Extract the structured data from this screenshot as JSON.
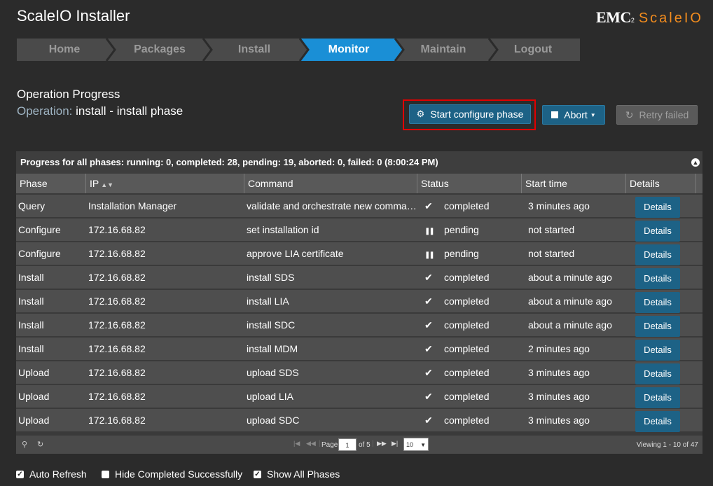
{
  "app": {
    "title": "ScaleIO Installer",
    "logo_brand": "EMC",
    "logo_sup": "2",
    "logo_product": "ScaleIO"
  },
  "wizard": {
    "steps": [
      "Home",
      "Packages",
      "Install",
      "Monitor",
      "Maintain",
      "Logout"
    ],
    "active_index": 3
  },
  "operation": {
    "heading": "Operation Progress",
    "label": "Operation:",
    "value": "install - install phase"
  },
  "actions": {
    "start_configure": "Start configure phase",
    "abort": "Abort",
    "retry_failed": "Retry failed"
  },
  "grid": {
    "caption": "Progress for all phases: running: 0, completed: 28, pending: 19, aborted: 0, failed: 0 (8:00:24 PM)",
    "columns": [
      "Phase",
      "IP",
      "Command",
      "Status",
      "Start time",
      "Details"
    ],
    "details_label": "Details",
    "rows": [
      {
        "phase": "Query",
        "ip": "Installation Manager",
        "command": "validate and orchestrate new commands",
        "status": "completed",
        "status_icon": "check-icon",
        "start": "3 minutes ago"
      },
      {
        "phase": "Configure",
        "ip": "172.16.68.82",
        "command": "set installation id",
        "status": "pending",
        "status_icon": "pause-icon",
        "start": "not started"
      },
      {
        "phase": "Configure",
        "ip": "172.16.68.82",
        "command": "approve LIA certificate",
        "status": "pending",
        "status_icon": "pause-icon",
        "start": "not started"
      },
      {
        "phase": "Install",
        "ip": "172.16.68.82",
        "command": "install SDS",
        "status": "completed",
        "status_icon": "check-icon",
        "start": "about a minute ago"
      },
      {
        "phase": "Install",
        "ip": "172.16.68.82",
        "command": "install LIA",
        "status": "completed",
        "status_icon": "check-icon",
        "start": "about a minute ago"
      },
      {
        "phase": "Install",
        "ip": "172.16.68.82",
        "command": "install SDC",
        "status": "completed",
        "status_icon": "check-icon",
        "start": "about a minute ago"
      },
      {
        "phase": "Install",
        "ip": "172.16.68.82",
        "command": "install MDM",
        "status": "completed",
        "status_icon": "check-icon",
        "start": "2 minutes ago"
      },
      {
        "phase": "Upload",
        "ip": "172.16.68.82",
        "command": "upload SDS",
        "status": "completed",
        "status_icon": "check-icon",
        "start": "3 minutes ago"
      },
      {
        "phase": "Upload",
        "ip": "172.16.68.82",
        "command": "upload LIA",
        "status": "completed",
        "status_icon": "check-icon",
        "start": "3 minutes ago"
      },
      {
        "phase": "Upload",
        "ip": "172.16.68.82",
        "command": "upload SDC",
        "status": "completed",
        "status_icon": "check-icon",
        "start": "3 minutes ago"
      }
    ]
  },
  "pager": {
    "page_label": "Page",
    "page_value": "1",
    "of_label": "of 5",
    "page_size": "10",
    "viewing": "Viewing 1 - 10 of 47"
  },
  "options": {
    "auto_refresh": "Auto Refresh",
    "hide_completed": "Hide Completed Successfully",
    "show_all": "Show All Phases"
  },
  "colors": {
    "accent": "#1d6286",
    "active_step": "#1a8fd6",
    "logo_orange": "#f28c1e",
    "highlight": "#e00000"
  }
}
